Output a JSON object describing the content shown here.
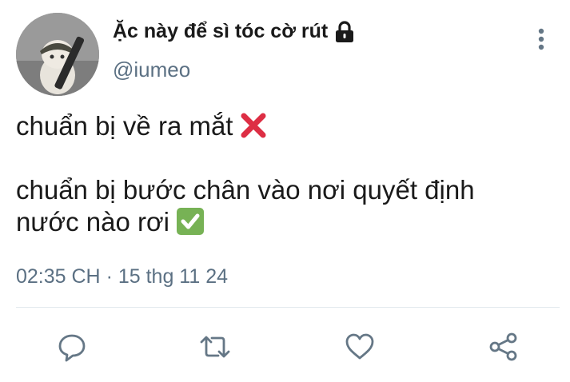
{
  "tweet": {
    "display_name": "Ặc này để sì tóc cờ rút",
    "handle": "@iumeo",
    "line1": "chuẩn bị về ra mắt",
    "line2": "chuẩn bị bước chân vào nơi quyết định",
    "line3": "nước nào rơi",
    "time": "02:35 CH",
    "separator": "·",
    "date": "15 thg 11 24"
  },
  "icons": {
    "lock": "lock-icon",
    "more": "more-vertical-icon",
    "cross": "cross-mark-emoji",
    "check": "check-mark-emoji",
    "reply": "reply-icon",
    "retweet": "retweet-icon",
    "like": "heart-icon",
    "share": "share-icon"
  },
  "colors": {
    "text": "#1a1a1a",
    "muted": "#5b7083",
    "icon": "#657786",
    "divider": "#e1e8ed",
    "cross": "#dd2e44",
    "check": "#77b255"
  }
}
